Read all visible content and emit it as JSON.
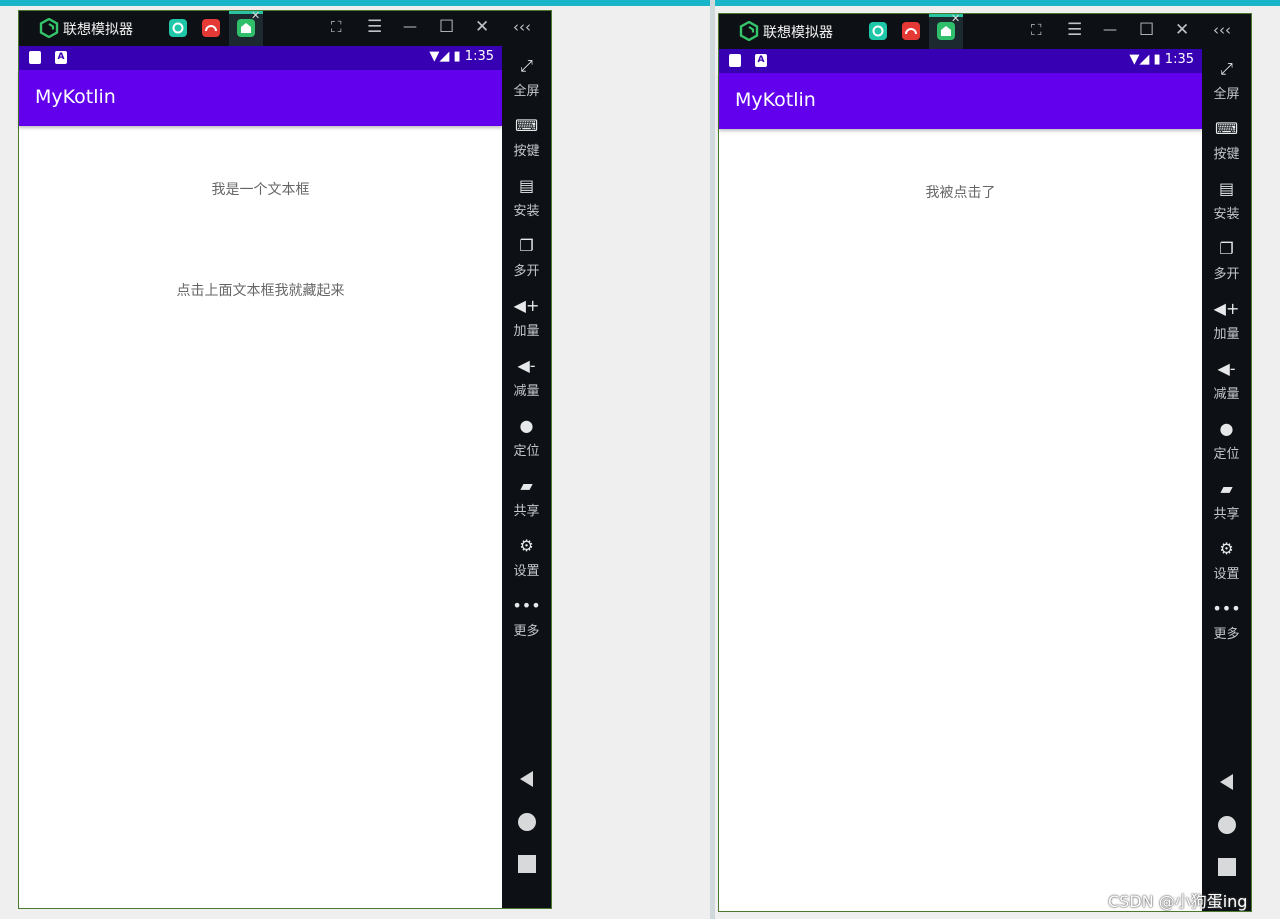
{
  "emulator": {
    "app_title": "联想模拟器",
    "tab_close": "✕",
    "window_buttons": [
      "⛶",
      "☰",
      "—",
      "☐",
      "✕",
      "‹‹‹"
    ]
  },
  "status_bar": {
    "time": "1:35",
    "left_icon_a": "A"
  },
  "app": {
    "title": "MyKotlin"
  },
  "left_screen": {
    "text_view": "我是一个文本框",
    "hint_text": "点击上面文本框我就藏起来"
  },
  "right_screen": {
    "text_view": "我被点击了"
  },
  "sidebar": {
    "items": [
      {
        "icon": "fullscreen-icon",
        "label": "全屏"
      },
      {
        "icon": "keyboard-icon",
        "label": "按键"
      },
      {
        "icon": "apk-icon",
        "label": "安装"
      },
      {
        "icon": "multi-open-icon",
        "label": "多开"
      },
      {
        "icon": "volume-up-icon",
        "label": "加量"
      },
      {
        "icon": "volume-down-icon",
        "label": "减量"
      },
      {
        "icon": "location-icon",
        "label": "定位"
      },
      {
        "icon": "folder-icon",
        "label": "共享"
      },
      {
        "icon": "gear-icon",
        "label": "设置"
      },
      {
        "icon": "more-icon",
        "label": "更多"
      }
    ]
  },
  "colors": {
    "status_bar": "#3700b3",
    "app_bar": "#6200ee",
    "emulator_frame": "#0d1014",
    "top_accent": "#19b5c8"
  },
  "watermark": "CSDN @小狗蛋ing"
}
